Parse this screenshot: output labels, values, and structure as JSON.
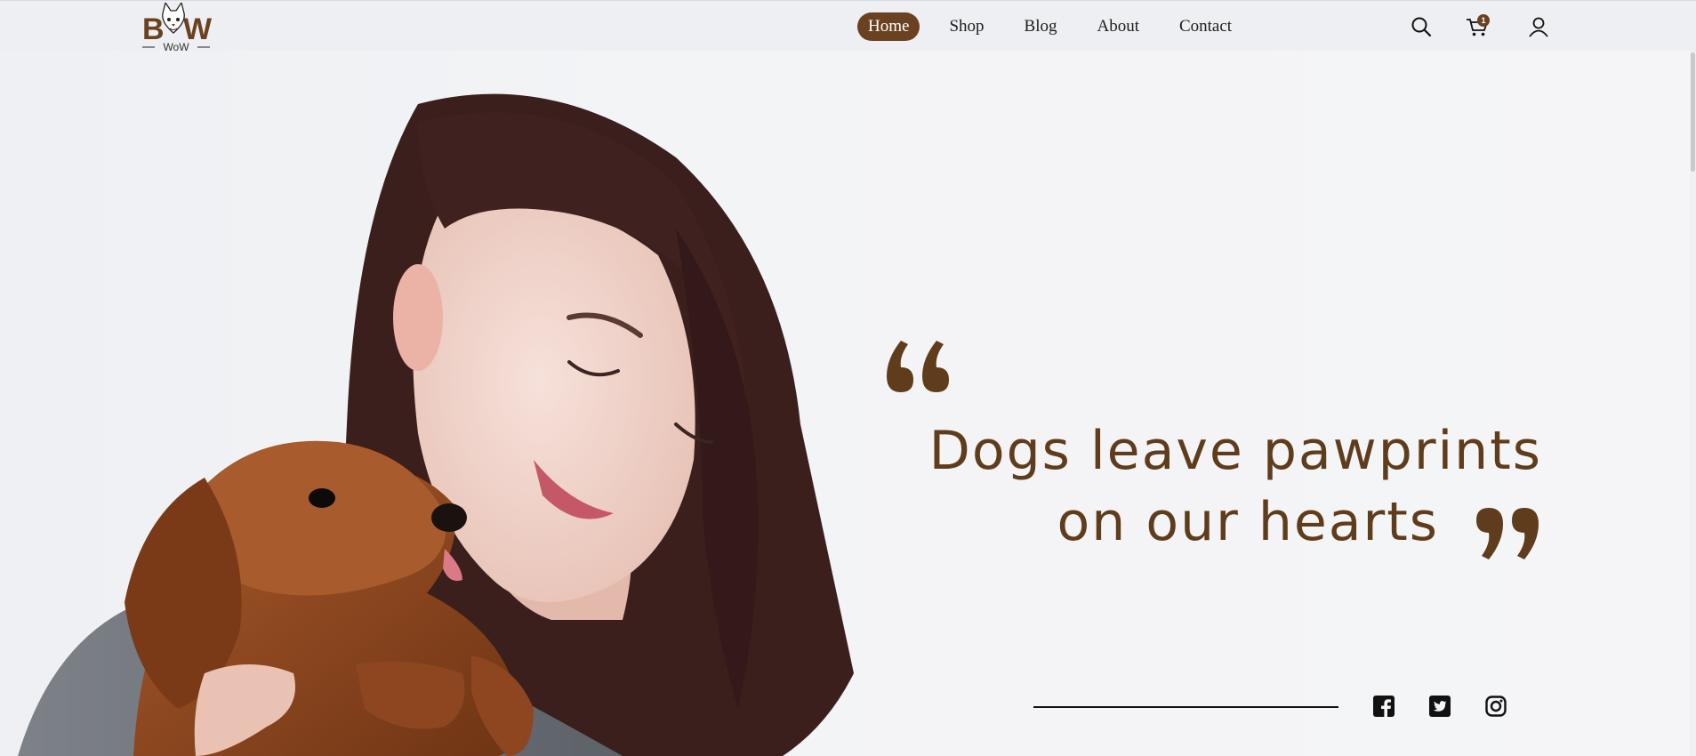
{
  "brand": {
    "logo_text_left": "B",
    "logo_text_right": "W",
    "logo_subtext": "WoW"
  },
  "nav": {
    "links": [
      {
        "label": "Home",
        "active": true
      },
      {
        "label": "Shop",
        "active": false
      },
      {
        "label": "Blog",
        "active": false
      },
      {
        "label": "About",
        "active": false
      },
      {
        "label": "Contact",
        "active": false
      }
    ],
    "icons": [
      "search-icon",
      "cart-icon",
      "user-icon"
    ],
    "cart_count": "1"
  },
  "hero": {
    "quote_line_1": "Dogs leave pawprints",
    "quote_line_2": "on our hearts"
  },
  "social": {
    "icons": [
      "facebook-icon",
      "twitter-icon",
      "instagram-icon"
    ]
  },
  "colors": {
    "brand": "#6b4221",
    "quote": "#5f3c1b",
    "background": "#f0f1f4"
  }
}
